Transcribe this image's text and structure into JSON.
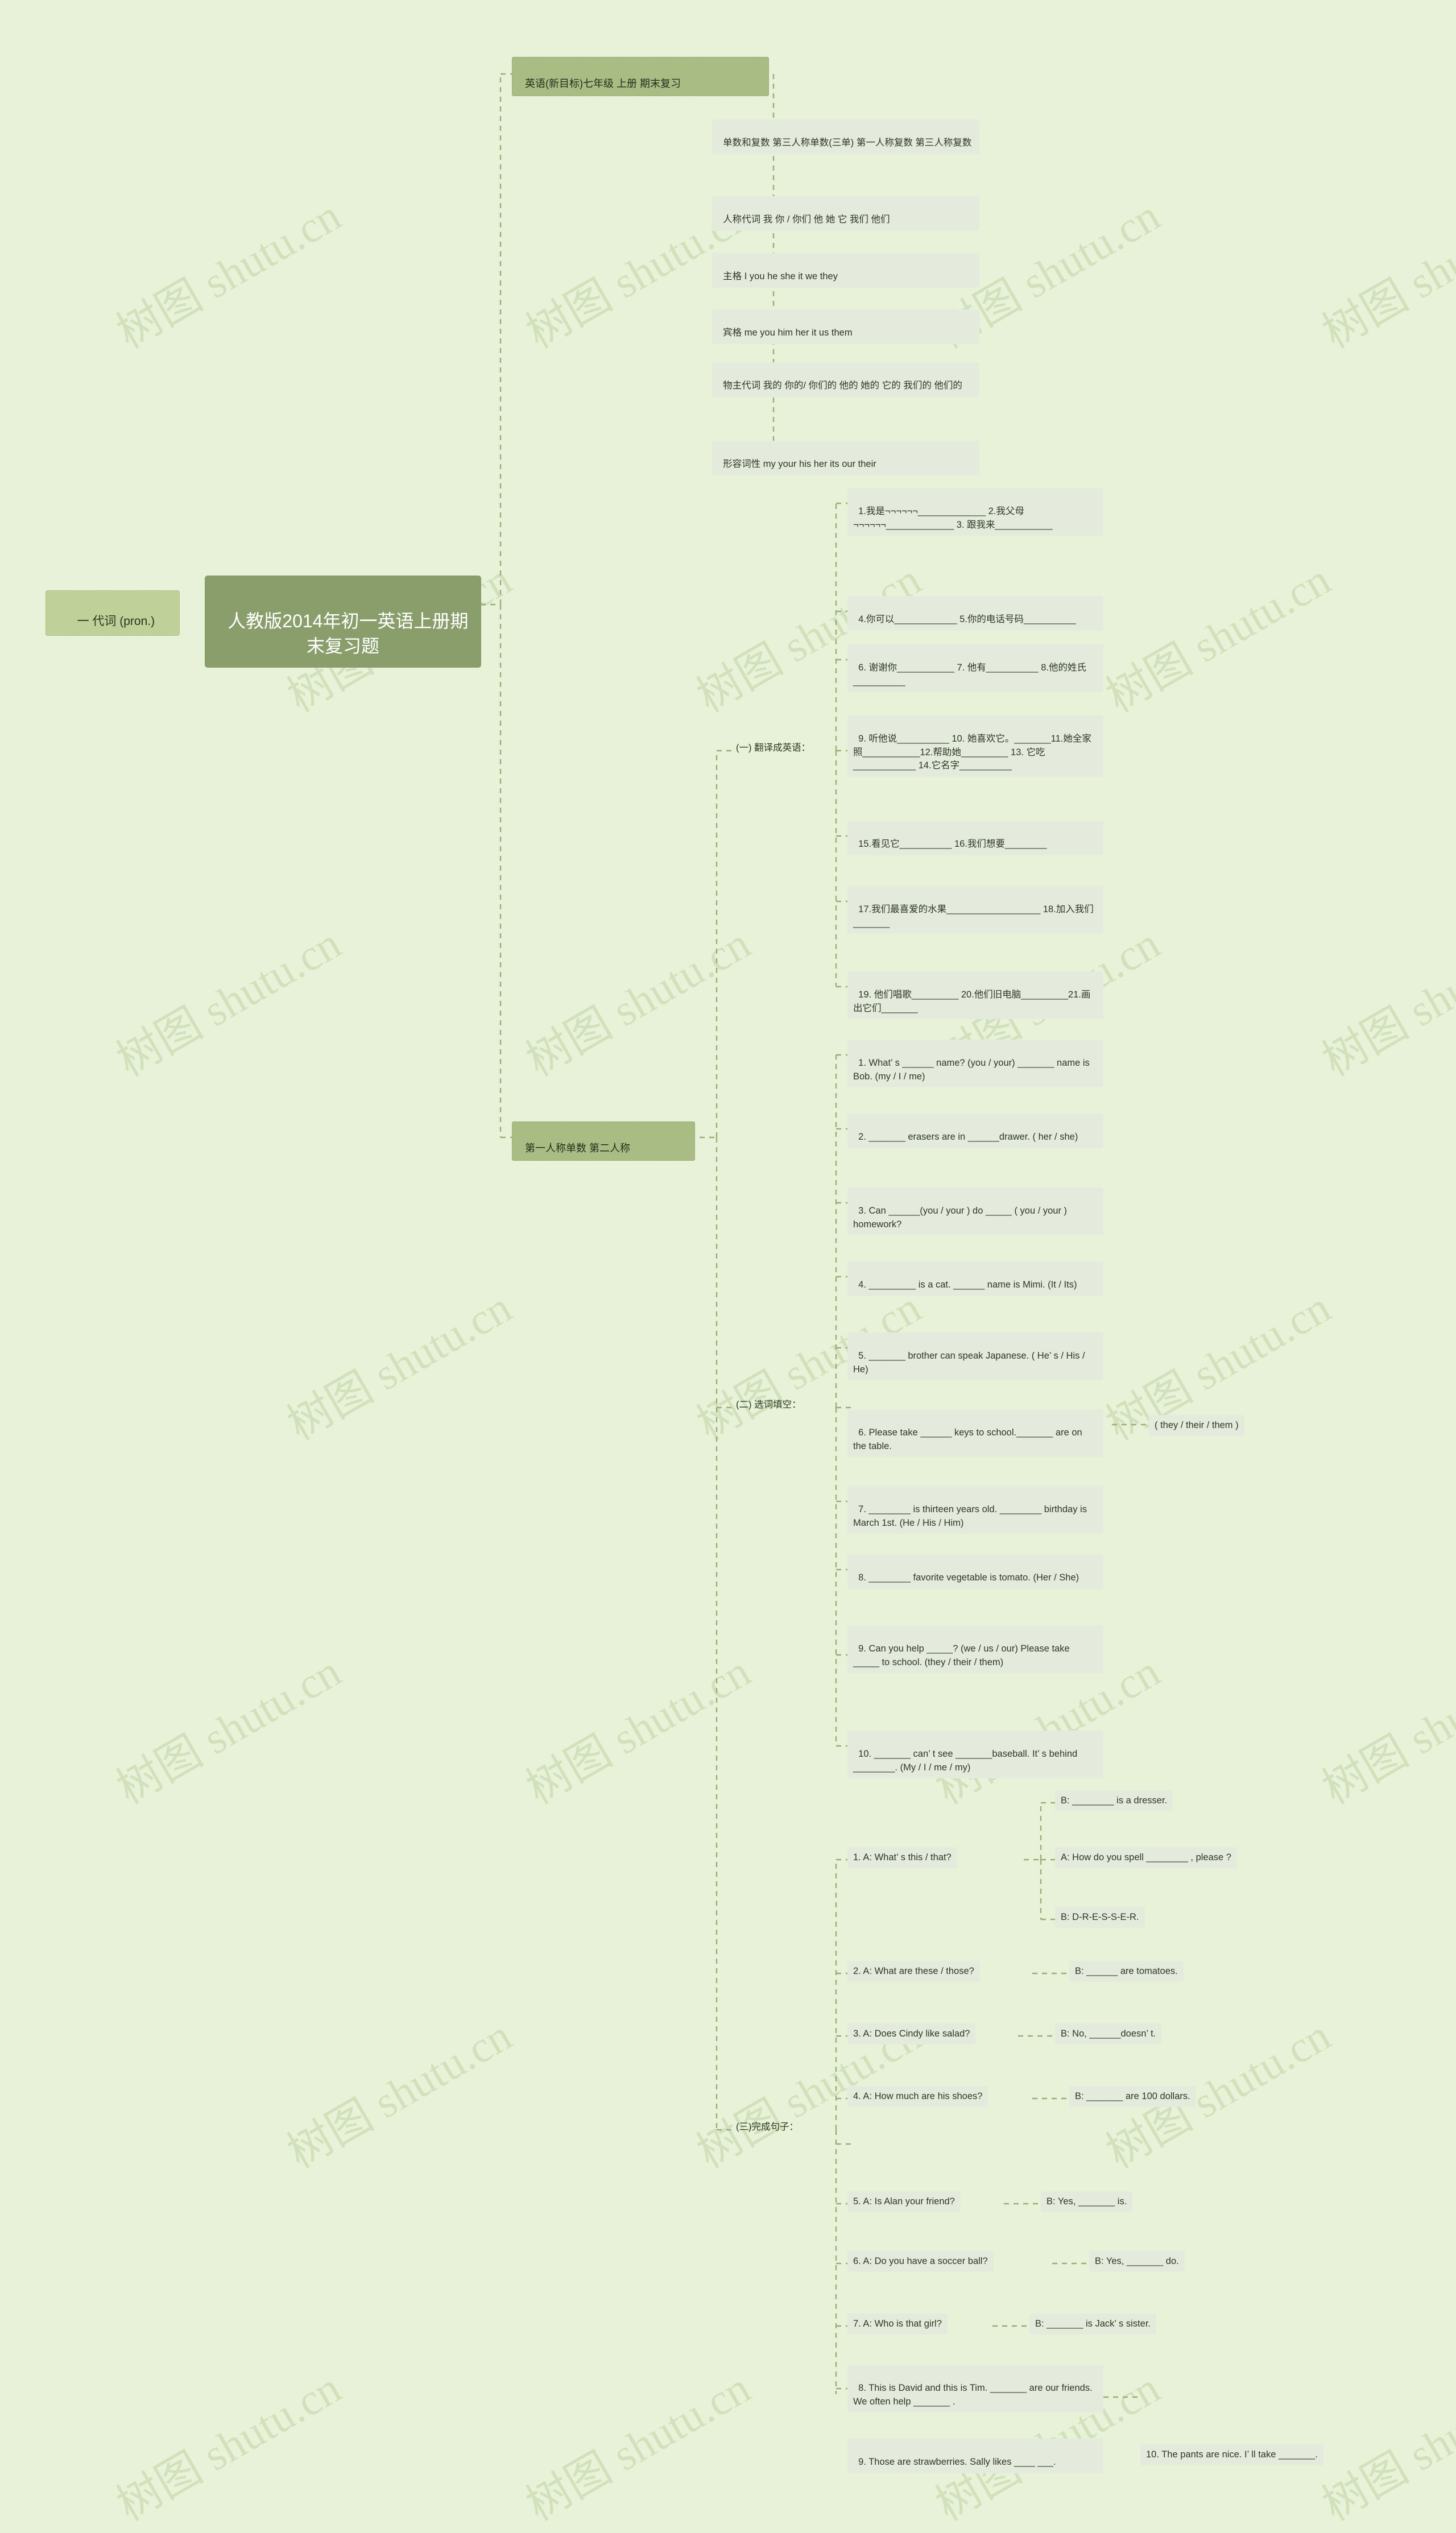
{
  "meta": {
    "bg_color": "#e8f2d8",
    "root_color": "#8a9e6c",
    "branch_color": "#bfd098",
    "leaf_color": "#e4ebdc",
    "line_color": "#9aad79"
  },
  "watermark": {
    "text_cn": "树图 shutu.cn"
  },
  "root": {
    "title": "人教版2014年初一英语上册期末复习题"
  },
  "branch_left": {
    "label": "一 代词 (pron.)"
  },
  "branch_top": {
    "label": "英语(新目标)七年级 上册 期末复习"
  },
  "branch_mid": {
    "label": "第一人称单数 第二人称"
  },
  "grammar_notes": [
    "单数和复数 第三人称单数(三单) 第一人称复数 第三人称复数",
    "人称代词 我 你 / 你们 他 她 它 我们 他们",
    "主格 I you he she it we they",
    "宾格 me you him her it us them",
    "物主代词 我的 你的/ 你们的 他的 她的 它的 我们的 他们的",
    "形容词性 my your his her its our their"
  ],
  "section_one": {
    "label": "(一) 翻译成英语：",
    "items": [
      "1.我是¬¬¬¬¬¬_____________ 2.我父母¬¬¬¬¬¬_____________ 3. 跟我来___________",
      "4.你可以____________ 5.你的电话号码__________",
      "6. 谢谢你___________ 7. 他有__________ 8.他的姓氏__________",
      "9. 听他说__________ 10. 她喜欢它。_______11.她全家照___________12.帮助她_________ 13. 它吃____________ 14.它名字__________",
      "15.看见它__________ 16.我们想要________",
      "17.我们最喜爱的水果__________________ 18.加入我们_______",
      "19. 他们唱歌_________ 20.他们旧电脑_________21.画出它们_______"
    ]
  },
  "section_two": {
    "label": "(二) 选词填空：",
    "items": [
      "1. What’ s ______ name? (you / your) _______ name is Bob. (my / I / me)",
      "2. _______ erasers are in ______drawer. ( her / she)",
      "3. Can ______(you / your ) do _____ ( you / your ) homework?",
      "4. _________ is a cat. ______ name is Mimi. (It / Its)",
      "5. _______ brother can speak Japanese. ( He’ s / His / He)",
      "6. Please take ______ keys to school._______ are on the table.",
      "7. ________ is thirteen years old. ________ birthday is March 1st. (He / His / Him)",
      "8. ________ favorite vegetable is tomato. (Her / She)",
      "9. Can you help _____? (we / us / our) Please take _____ to school. (they / their / them)",
      "10. _______ can’ t see _______baseball. It’ s behind ________. (My / I / me / my)"
    ],
    "item6_choices": "( they / their / them )"
  },
  "section_three": {
    "label": "(三)完成句子：",
    "items": [
      {
        "prompt": "1. A: What’ s this / that?",
        "replies": [
          "B: ________ is a dresser.",
          "A: How do you spell ________ , please ?",
          "B: D-R-E-S-S-E-R."
        ]
      },
      {
        "prompt": "2. A: What are these / those?",
        "reply": "B: ______ are tomatoes."
      },
      {
        "prompt": "3. A: Does Cindy like salad?",
        "reply": "B: No, ______doesn’ t."
      },
      {
        "prompt": "4. A: How much are his shoes?",
        "reply": "B: _______ are 100 dollars."
      },
      {
        "prompt": "5. A: Is Alan your friend?",
        "reply": "B: Yes, _______ is."
      },
      {
        "prompt": "6. A: Do you have a soccer ball?",
        "reply": "B: Yes, _______ do."
      },
      {
        "prompt": "7. A: Who is that girl?",
        "reply": "B: _______ is Jack’ s sister."
      },
      {
        "prompt": "8. This is David and this is Tim. _______ are our friends. We often help _______ .",
        "reply": ""
      },
      {
        "prompt": "9. Those are strawberries. Sally likes ____ ___.",
        "reply": "10. The pants are nice. I’ ll take _______."
      }
    ]
  }
}
